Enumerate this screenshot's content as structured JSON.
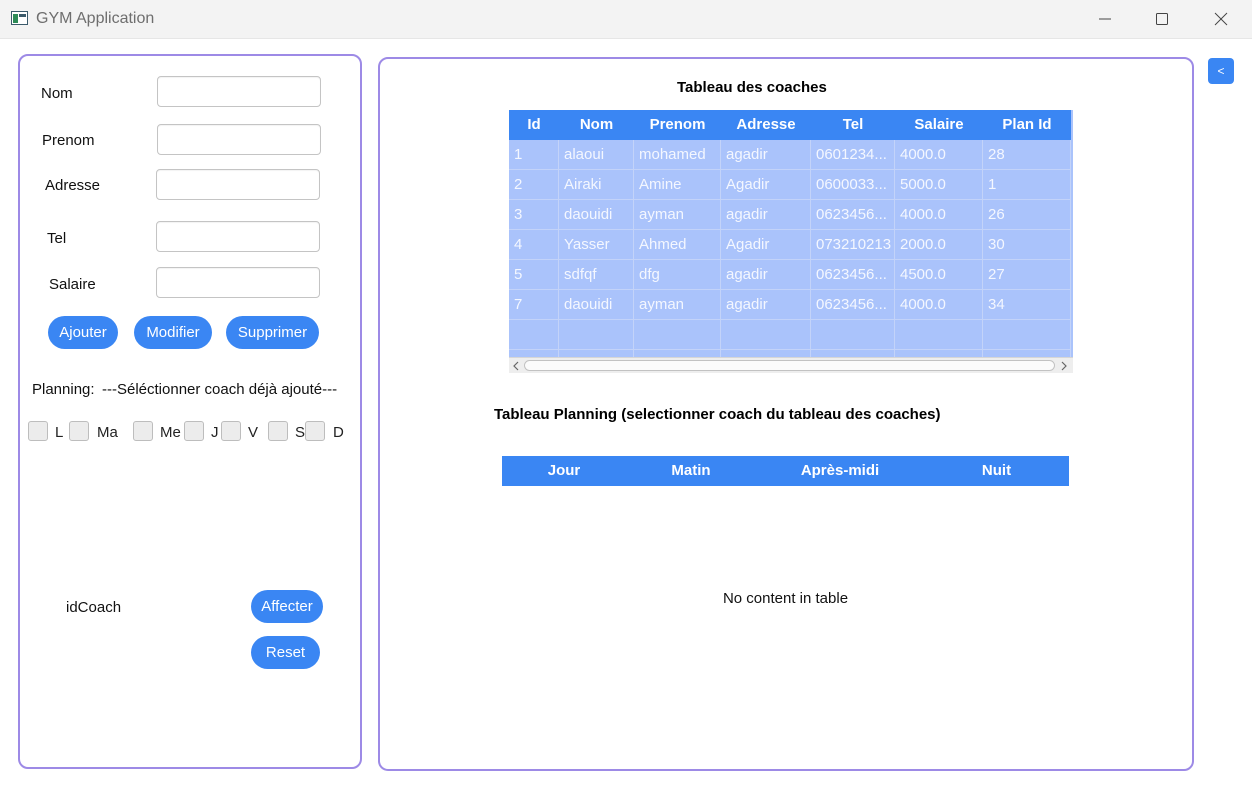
{
  "window": {
    "title": "GYM Application",
    "icon": "app-window-icon",
    "controls": [
      "minimize-icon",
      "maximize-icon",
      "close-icon"
    ]
  },
  "form": {
    "nom_label": "Nom",
    "prenom_label": "Prenom",
    "adresse_label": "Adresse",
    "tel_label": "Tel",
    "salaire_label": "Salaire",
    "nom_value": "",
    "prenom_value": "",
    "adresse_value": "",
    "tel_value": "",
    "salaire_value": "",
    "ajouter_label": "Ajouter",
    "modifier_label": "Modifier",
    "supprimer_label": "Supprimer"
  },
  "planning": {
    "label": "Planning:",
    "hint": "---Séléctionner coach déjà ajouté---",
    "days": [
      "L",
      "Ma",
      "Me",
      "J",
      "V",
      "S",
      "D"
    ],
    "idcoach_label": "idCoach",
    "affecter_label": "Affecter",
    "reset_label": "Reset"
  },
  "coaches_table": {
    "title": "Tableau des coaches",
    "columns": [
      "Id",
      "Nom",
      "Prenom",
      "Adresse",
      "Tel",
      "Salaire",
      "Plan Id"
    ],
    "rows": [
      [
        "1",
        "alaoui",
        "mohamed",
        "agadir",
        "0601234...",
        "4000.0",
        "28"
      ],
      [
        "2",
        "Airaki",
        "Amine",
        "Agadir",
        "0600033...",
        "5000.0",
        "1"
      ],
      [
        "3",
        "daouidi",
        "ayman",
        "agadir",
        "0623456...",
        "4000.0",
        "26"
      ],
      [
        "4",
        "Yasser",
        "Ahmed",
        "Agadir",
        "073210213",
        "2000.0",
        "30"
      ],
      [
        "5",
        "sdfqf",
        "dfg",
        "agadir",
        "0623456...",
        "4500.0",
        "27"
      ],
      [
        "7",
        "daouidi",
        "ayman",
        "agadir",
        "0623456...",
        "4000.0",
        "34"
      ]
    ]
  },
  "planning_table": {
    "title": "Tableau Planning (selectionner coach du tableau des coaches)",
    "columns": [
      "Jour",
      "Matin",
      "Après-midi",
      "Nuit"
    ],
    "placeholder": "No content in table"
  },
  "side_button": {
    "label": "<"
  },
  "colors": {
    "accent": "#3a86f3",
    "panel_border": "#9d8ae6",
    "row_fill": "#aac3fb"
  }
}
